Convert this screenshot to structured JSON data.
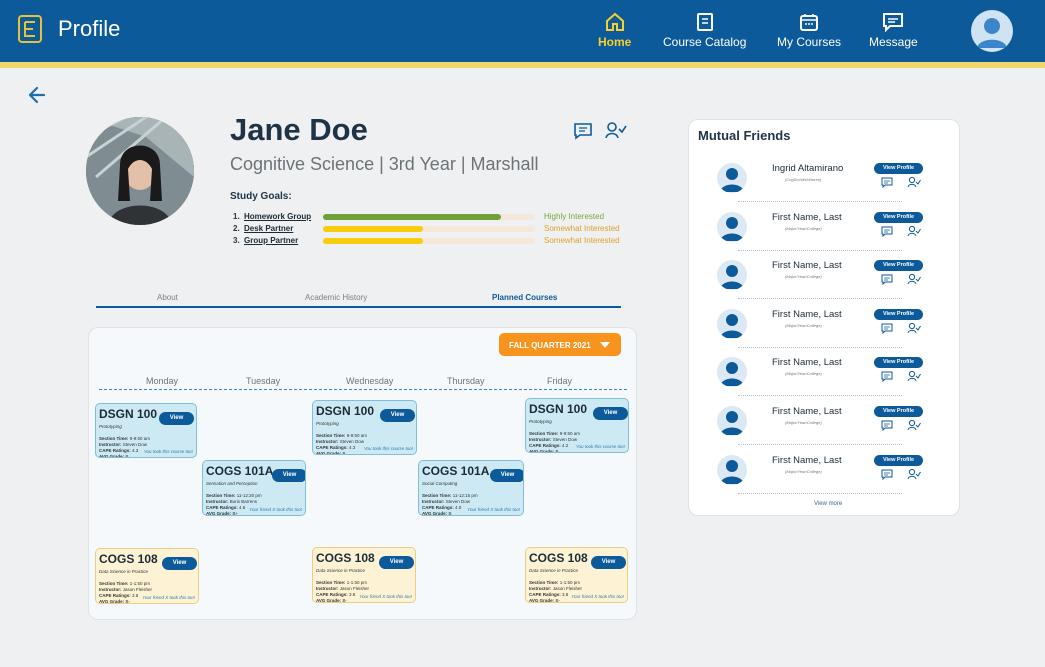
{
  "header": {
    "title": "Profile",
    "nav": [
      {
        "label": "Home",
        "icon": "home-icon",
        "active": true
      },
      {
        "label": "Course Catalog",
        "icon": "catalog-icon",
        "active": false
      },
      {
        "label": "My Courses",
        "icon": "calendar-icon",
        "active": false
      },
      {
        "label": "Message",
        "icon": "message-icon",
        "active": false
      }
    ]
  },
  "profile": {
    "name": "Jane Doe",
    "subtitle": "Cognitive Science | 3rd Year | Marshall",
    "goals_title": "Study Goals:",
    "goals": [
      {
        "num": "1.",
        "label": "Homework Group",
        "level": "Highly Interested",
        "fill_fraction": 0.84,
        "color": "#6ea236"
      },
      {
        "num": "2.",
        "label": "Desk Partner",
        "level": "Somewhat Interested",
        "fill_fraction": 0.47,
        "color": "#f7cd0f"
      },
      {
        "num": "3.",
        "label": "Group Partner",
        "level": "Somewhat Interested",
        "fill_fraction": 0.47,
        "color": "#f7cd0f"
      }
    ]
  },
  "tabs": [
    {
      "label": "About",
      "active": false
    },
    {
      "label": "Academic History",
      "active": false
    },
    {
      "label": "Planned Courses",
      "active": true
    }
  ],
  "schedule": {
    "quarter": "FALL QUARTER 2021",
    "days": [
      "Monday",
      "Tuesday",
      "Wednesday",
      "Thursday",
      "Friday"
    ],
    "view_label": "View",
    "cards": [
      {
        "code": "DSGN 100",
        "title": "Prototyping",
        "section": "9-9:50 am",
        "instructor": "Steven Dow",
        "cape": "4.3",
        "grade": "B",
        "footer": "You took this course too!",
        "color": "blue"
      },
      {
        "code": "DSGN 100",
        "title": "Prototyping",
        "section": "9-9:50 am",
        "instructor": "Steven Dow",
        "cape": "4.3",
        "grade": "B",
        "footer": "You took this course too!",
        "color": "blue"
      },
      {
        "code": "DSGN 100",
        "title": "Prototyping",
        "section": "9-9:50 am",
        "instructor": "Steven Dow",
        "cape": "4.2",
        "grade": "B",
        "footer": "You took this course too!",
        "color": "blue"
      },
      {
        "code": "COGS 101A",
        "title": "Sensation and Perception",
        "section": "11-12:20 pm",
        "instructor": "Boris Barrens",
        "cape": "4.6",
        "grade": "B+",
        "footer": "Your friend X took this too!",
        "color": "blue"
      },
      {
        "code": "COGS 101A",
        "title": "Social Computing",
        "section": "11-12:15 pm",
        "instructor": "Steven Dow",
        "cape": "4.0",
        "grade": "B",
        "footer": "Your friend X took this too!",
        "color": "blue"
      },
      {
        "code": "COGS 108",
        "title": "Data Science in Practice",
        "section": "1-1:50 pm",
        "instructor": "Jason Fleisher",
        "cape": "3.8",
        "grade": "B-",
        "footer": "Your friend X took this too!",
        "color": "yellow"
      },
      {
        "code": "COGS 108",
        "title": "Data Science in Practice",
        "section": "1-1:50 pm",
        "instructor": "Jason Fleisher",
        "cape": "3.8",
        "grade": "B-",
        "footer": "Your friend X took this too!",
        "color": "yellow"
      },
      {
        "code": "COGS 108",
        "title": "Data Science in Practice",
        "section": "1-1:50 pm",
        "instructor": "Jason Fleisher",
        "cape": "3.8",
        "grade": "B-",
        "footer": "Your friend X took this too!",
        "color": "yellow"
      }
    ],
    "field_labels": {
      "section": "Section Time:",
      "instructor": "Instructor:",
      "cape": "CAPE Ratings:",
      "grade": "AVG Grade:"
    }
  },
  "mutual_friends": {
    "title": "Mutual Friends",
    "button_label": "View Profile",
    "view_more": "View more",
    "friends": [
      {
        "name": "Ingrid Altamirano",
        "meta": "(CogSci/4th/Warren)"
      },
      {
        "name": "First Name, Last",
        "meta": "(Major/Year/College)"
      },
      {
        "name": "First Name, Last",
        "meta": "(Major/Year/College)"
      },
      {
        "name": "First Name, Last",
        "meta": "(Major/Year/College)"
      },
      {
        "name": "First Name, Last",
        "meta": "(Major/Year/College)"
      },
      {
        "name": "First Name, Last",
        "meta": "(Major/Year/College)"
      },
      {
        "name": "First Name, Last",
        "meta": "(Major/Year/College)"
      }
    ]
  },
  "colors": {
    "primary": "#0d5a9a",
    "accent": "#f7941d",
    "highlight": "#f7cf2e"
  }
}
